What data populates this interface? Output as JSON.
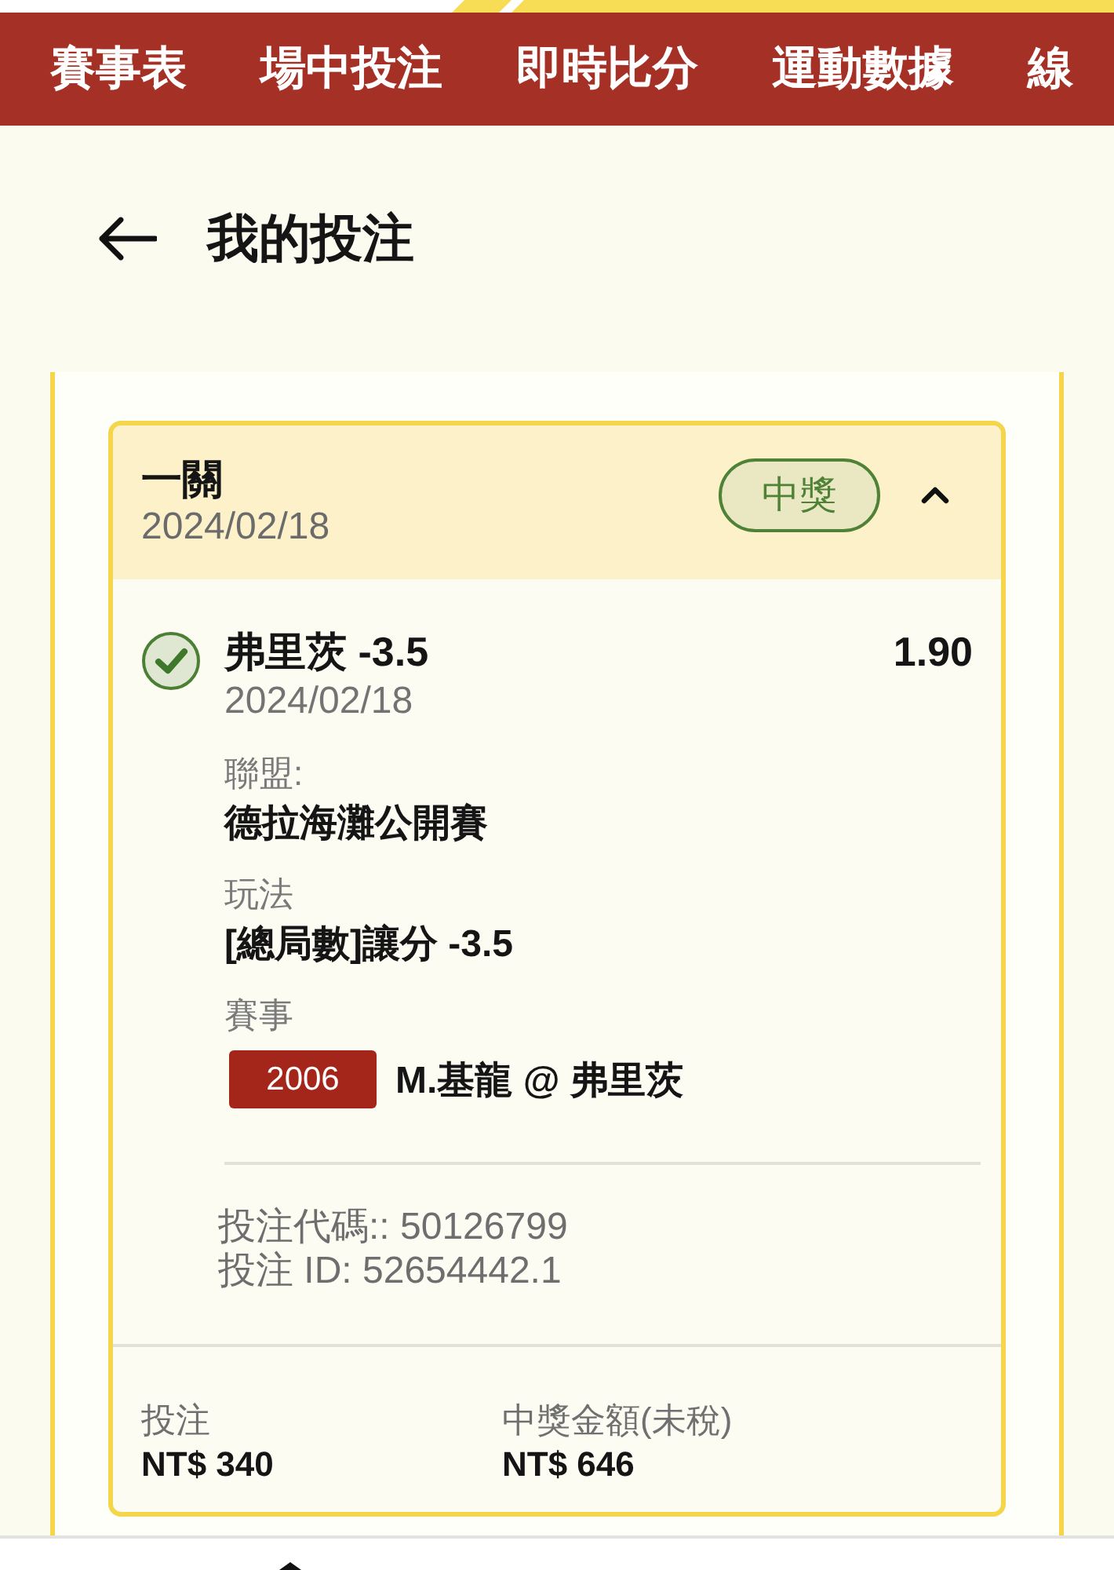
{
  "top_nav": {
    "tabs": [
      "賽事表",
      "場中投注",
      "即時比分",
      "運動數據",
      "線"
    ]
  },
  "header": {
    "title": "我的投注"
  },
  "bet": {
    "type": "一關",
    "date": "2024/02/18",
    "status": "中獎",
    "expanded": true,
    "selections": [
      {
        "won": true,
        "name": "弗里茨 -3.5",
        "odds": "1.90",
        "date": "2024/02/18",
        "details": [
          {
            "label": "聯盟:",
            "value": "德拉海灘公開賽"
          },
          {
            "label": "玩法",
            "value": "[總局數]讓分 -3.5"
          }
        ],
        "event": {
          "label": "賽事",
          "code": "2006",
          "match": "M.基龍 @ 弗里茨"
        },
        "bet_code": "投注代碼:: 50126799",
        "bet_id": "投注 ID: 52654442.1"
      }
    ],
    "summary": [
      {
        "label": "投注",
        "value": "NT$ 340"
      },
      {
        "label": "中獎金額(未稅)",
        "value": "NT$ 646"
      }
    ]
  }
}
